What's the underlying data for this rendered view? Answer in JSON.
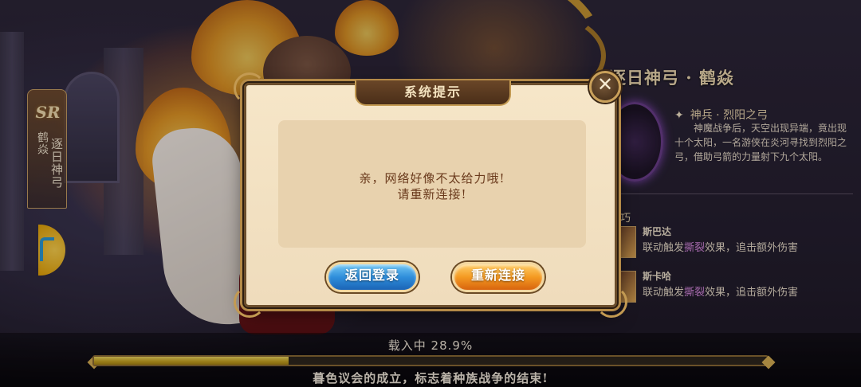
{
  "left_card": {
    "rarity": "SR",
    "name_short": "鹤焱",
    "name_title": "逐日神弓"
  },
  "hero_panel": {
    "title": "逐日神弓 · 鹤焱",
    "weapon_name": "神兵 · 烈阳之弓",
    "weapon_desc": "神魔战争后，天空出现异端，竟出现十个太阳，一名游侠在炎河寻找到烈阳之弓，借助弓箭的力量射下九个太阳。",
    "skill_tag": "巧",
    "synergies": [
      {
        "name": "斯巴达",
        "prefix": "联动触发",
        "keyword": "撕裂",
        "suffix": "效果，追击额外伤害"
      },
      {
        "name": "斯卡哈",
        "prefix": "联动触发",
        "keyword": "撕裂",
        "suffix": "效果，追击额外伤害"
      }
    ]
  },
  "dialog": {
    "title": "系统提示",
    "message_line1": "亲，网络好像不太给力哦!",
    "message_line2": "请重新连接!",
    "back_button": "返回登录",
    "retry_button": "重新连接",
    "close_icon": "close-icon"
  },
  "loading": {
    "text": "载入中 28.9%",
    "progress_percent": 28.9,
    "tip": "暮色议会的成立，标志着种族战争的结束!"
  },
  "colors": {
    "dialog_bg": "#efdcbc",
    "message_text": "#6a3a1c",
    "back_button": "#2f8edb",
    "retry_button": "#f49a22",
    "progress_fill": "#c9a41c"
  }
}
